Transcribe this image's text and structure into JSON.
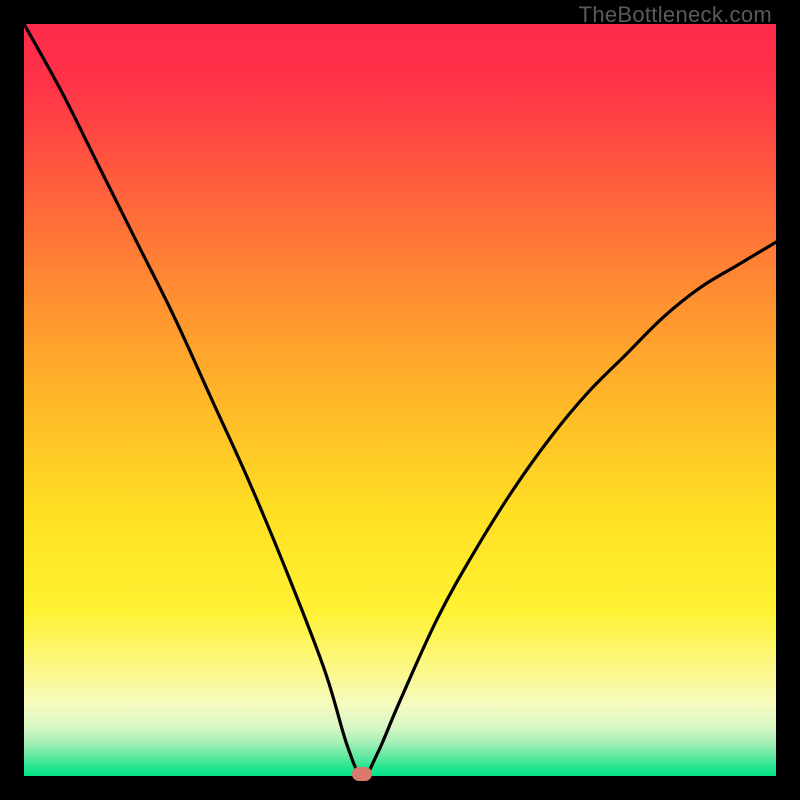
{
  "watermark": "TheBottleneck.com",
  "chart_data": {
    "type": "line",
    "title": "",
    "xlabel": "",
    "ylabel": "",
    "xlim": [
      0,
      100
    ],
    "ylim": [
      0,
      100
    ],
    "x": [
      0,
      5,
      10,
      15,
      20,
      25,
      30,
      35,
      40,
      43,
      45,
      47,
      50,
      55,
      60,
      65,
      70,
      75,
      80,
      85,
      90,
      95,
      100
    ],
    "values": [
      100,
      91,
      81,
      71,
      61,
      50,
      39,
      27,
      14,
      4,
      0,
      3,
      10,
      21,
      30,
      38,
      45,
      51,
      56,
      61,
      65,
      68,
      71
    ],
    "markers": [
      {
        "x": 45,
        "y": 0,
        "color": "#d97a6c",
        "shape": "pill"
      }
    ],
    "gradient_stops": [
      {
        "offset": 0.0,
        "color": "#ff2b4b"
      },
      {
        "offset": 0.08,
        "color": "#ff3348"
      },
      {
        "offset": 0.2,
        "color": "#ff5a3e"
      },
      {
        "offset": 0.35,
        "color": "#ff8b32"
      },
      {
        "offset": 0.5,
        "color": "#ffb728"
      },
      {
        "offset": 0.65,
        "color": "#ffdf24"
      },
      {
        "offset": 0.78,
        "color": "#fff232"
      },
      {
        "offset": 0.86,
        "color": "#fbf88a"
      },
      {
        "offset": 0.905,
        "color": "#f6fbc0"
      },
      {
        "offset": 0.935,
        "color": "#d8f7c4"
      },
      {
        "offset": 0.955,
        "color": "#a6f0b6"
      },
      {
        "offset": 0.975,
        "color": "#5de9a0"
      },
      {
        "offset": 0.99,
        "color": "#1fe48f"
      },
      {
        "offset": 1.0,
        "color": "#05e387"
      }
    ]
  }
}
